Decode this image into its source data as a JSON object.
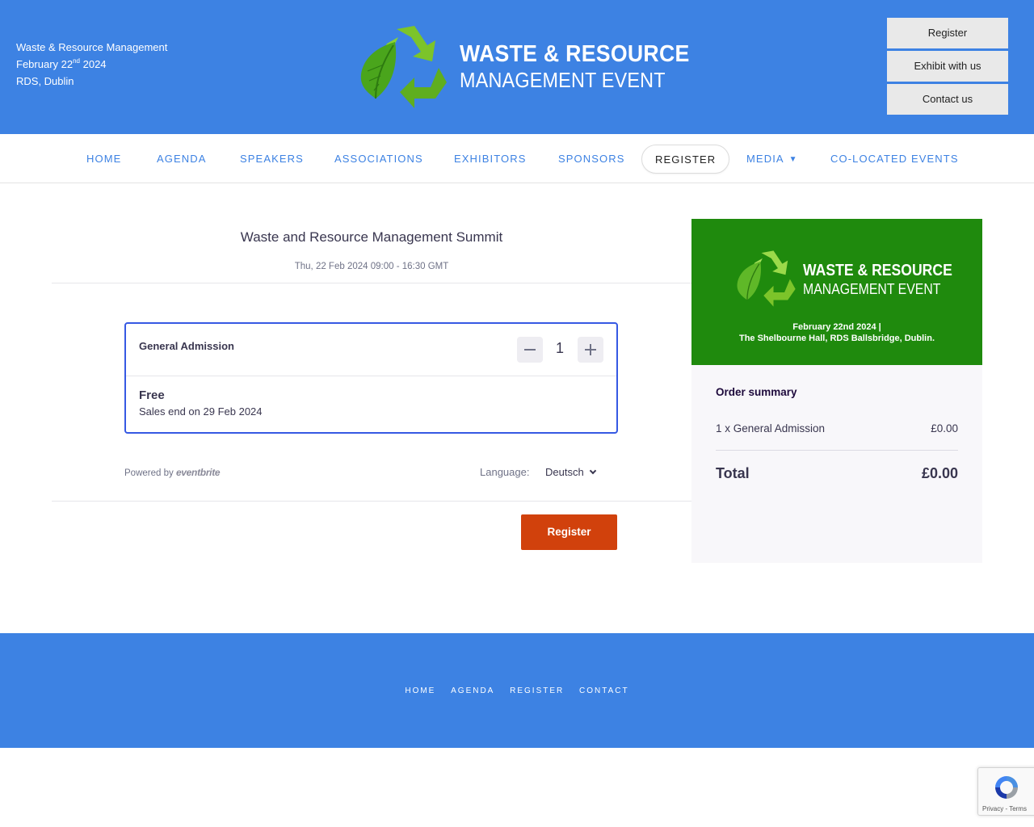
{
  "header": {
    "event_name": "Waste & Resource Management",
    "date_prefix": "February 22",
    "date_suffix_sup": "nd",
    "date_year": " 2024",
    "venue": "RDS, Dublin",
    "logo_line1": "WASTE & RESOURCE",
    "logo_line2": "MANAGEMENT EVENT",
    "buttons": [
      "Register",
      "Exhibit with us",
      "Contact us"
    ]
  },
  "nav": {
    "items": [
      "HOME",
      "AGENDA",
      "SPEAKERS",
      "ASSOCIATIONS",
      "EXHIBITORS",
      "SPONSORS",
      "REGISTER",
      "MEDIA",
      "CO-LOCATED EVENTS"
    ],
    "active": "REGISTER"
  },
  "checkout": {
    "title": "Waste and Resource Management Summit",
    "date": "Thu, 22 Feb 2024 09:00 - 16:30 GMT",
    "ticket": {
      "name": "General Admission",
      "quantity": "1",
      "price": "Free",
      "sales_end": "Sales end on 29 Feb 2024"
    },
    "powered_by": "Powered by",
    "powered_brand": "eventbrite",
    "language_label": "Language:",
    "language_value": "Deutsch",
    "register_label": "Register"
  },
  "summary": {
    "banner_line1": "WASTE & RESOURCE",
    "banner_line2": "MANAGEMENT EVENT",
    "banner_date": "February 22nd 2024 |",
    "banner_venue": "The Shelbourne Hall, RDS Ballsbridge, Dublin.",
    "title": "Order summary",
    "line_item": "1 x General Admission",
    "line_price": "£0.00",
    "total_label": "Total",
    "total_value": "£0.00"
  },
  "footer": {
    "links": [
      "HOME",
      "AGENDA",
      "REGISTER",
      "CONTACT"
    ]
  },
  "recaptcha": {
    "links": "Privacy - Terms"
  },
  "colors": {
    "brand_blue": "#3d82e3",
    "banner_green": "#1f8a0d",
    "register_orange": "#d1410c",
    "ticket_border": "#3659e3"
  },
  "icons": [
    "recycle-leaf-logo-icon",
    "minus-icon",
    "plus-icon",
    "chevron-down-icon",
    "recaptcha-icon"
  ]
}
